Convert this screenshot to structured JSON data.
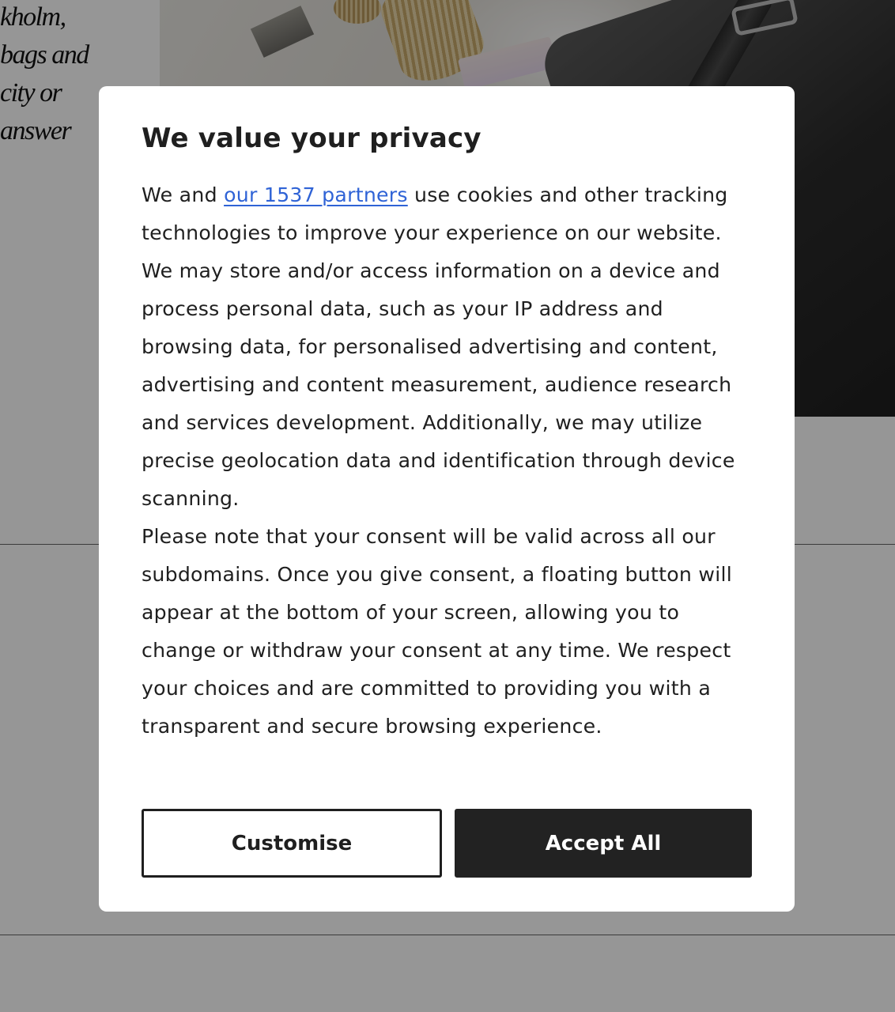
{
  "background": {
    "article_lines": [
      "kholm,",
      "bags and",
      "city or",
      "answer"
    ]
  },
  "consent": {
    "title": "We value your privacy",
    "body_intro_before_link": "We and ",
    "partners_link_label": "our 1537 partners",
    "body_intro_after_link": " use cookies and other tracking technologies to improve your experience on our website. We may store and/or access information on a device and process personal data, such as your IP address and browsing data, for personalised advertising and content, advertising and content measurement, audience research and services development. Additionally, we may utilize precise geolocation data and identification through device scanning.",
    "body_note": "Please note that your consent will be valid across all our subdomains. Once you give consent, a floating button will appear at the bottom of your screen, allowing you to change or withdraw your consent at any time. We respect your choices and are committed to providing you with a transparent and secure browsing experience.",
    "buttons": {
      "customise_label": "Customise",
      "accept_label": "Accept All"
    }
  },
  "colors": {
    "overlay": "#00000069",
    "link": "#2f63d6",
    "primary_button": "#222222",
    "text": "#1f1f1f"
  }
}
